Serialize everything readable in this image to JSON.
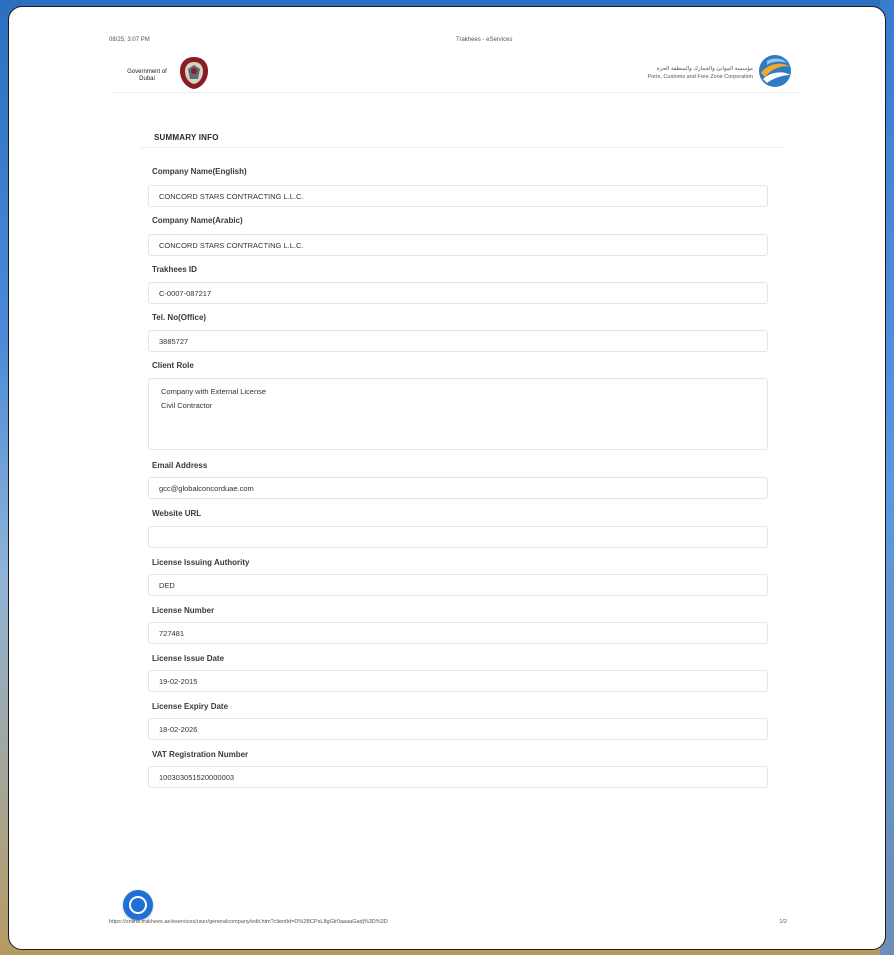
{
  "print_header": {
    "date": "08/25, 3:07 PM",
    "title": "Trakhees - eServices"
  },
  "banner": {
    "gov_text": "Government of Dubai",
    "pcfc_arabic": "مؤسسة الموانئ والجمارك والمنطقة الحرة",
    "pcfc_english": "Ports, Customs and Free Zone Corporation"
  },
  "section_title": "SUMMARY INFO",
  "fields": [
    {
      "label": "Company Name(English)",
      "value": "CONCORD STARS CONTRACTING L.L.C."
    },
    {
      "label": "Company Name(Arabic)",
      "value": "CONCORD STARS CONTRACTING L.L.C."
    },
    {
      "label": "Trakhees ID",
      "value": "C-0007-087217"
    },
    {
      "label": "Tel. No(Office)",
      "value": "3885727"
    },
    {
      "label": "Client Role",
      "lines": [
        "Company with External License",
        "Civil Contractor"
      ]
    },
    {
      "label": "Email Address",
      "value": "gcc@globalconcorduae.com"
    },
    {
      "label": "Website URL",
      "value": ""
    },
    {
      "label": "License Issuing Authority",
      "value": "DED"
    },
    {
      "label": "License Number",
      "value": "727481"
    },
    {
      "label": "License Issue Date",
      "value": "19-02-2015"
    },
    {
      "label": "License Expiry Date",
      "value": "18-02-2026"
    },
    {
      "label": "VAT Registration Number",
      "value": "100303051520000003"
    }
  ],
  "print_footer": {
    "url": "https://online.trakhees.ae/eservices/user/generalcompany/edit.htm?clientId=D%2BCPsL8gGlr0aaaaGadj%3D%3D",
    "page": "1/2"
  }
}
